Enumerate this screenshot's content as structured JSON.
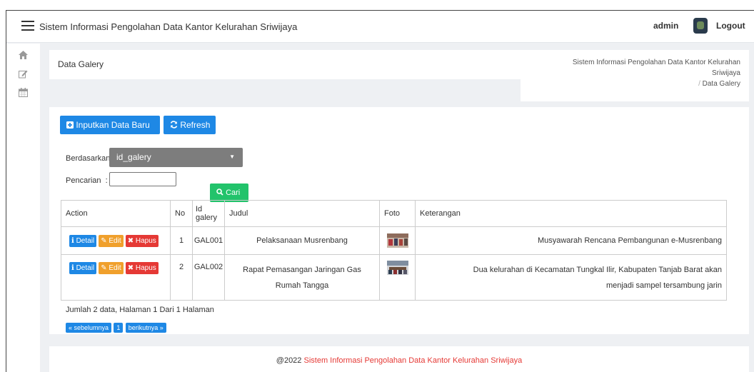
{
  "topbar": {
    "app_title": "Sistem Informasi Pengolahan Data Kantor Kelurahan Sriwijaya",
    "username": "admin",
    "logout_label": "Logout"
  },
  "sidebar": {
    "items": [
      {
        "icon": "home-icon"
      },
      {
        "icon": "edit-icon"
      },
      {
        "icon": "calendar-icon"
      }
    ]
  },
  "header": {
    "page_title": "Data Galery",
    "breadcrumb_root_line1": "Sistem Informasi Pengolahan Data Kantor Kelurahan",
    "breadcrumb_root_line2": "Sriwijaya",
    "breadcrumb_separator": "/",
    "breadcrumb_current": "Data Galery"
  },
  "toolbar": {
    "add_label": "Inputkan Data Baru",
    "refresh_label": "Refresh"
  },
  "filter": {
    "berdasarkan_label": "Berdasarkan",
    "field_selected": "id_galery",
    "pencarian_label": "Pencarian",
    "search_value": "",
    "search_button": "Cari"
  },
  "table": {
    "headers": [
      "Action",
      "No",
      "Id galery",
      "Judul",
      "Foto",
      "Keterangan"
    ],
    "action_labels": {
      "detail": "Detail",
      "edit": "Edit",
      "hapus": "Hapus"
    },
    "rows": [
      {
        "no": "1",
        "id": "GAL001",
        "judul": "Pelaksanaan Musrenbang",
        "judul2": "",
        "keterangan": "Musyawarah Rencana Pembangunan e-Musrenbang",
        "keterangan2": ""
      },
      {
        "no": "2",
        "id": "GAL002",
        "judul": "Rapat Pemasangan Jaringan Gas",
        "judul2": "Rumah Tangga",
        "keterangan": "Dua kelurahan di Kecamatan Tungkal Ilir, Kabupaten Tanjab Barat akan",
        "keterangan2": "menjadi sampel tersambung jarin"
      }
    ]
  },
  "pagination": {
    "summary": "Jumlah 2 data, Halaman 1 Dari 1 Halaman",
    "prev_label": "« sebelumnya",
    "current_page": "1",
    "next_label": "berikutnya »"
  },
  "footer": {
    "prefix": "@2022",
    "link_text": "Sistem Informasi Pengolahan Data Kantor Kelurahan Sriwijaya"
  },
  "colors": {
    "primary": "#1e88e5",
    "success": "#22c36b",
    "warning": "#f0a02c",
    "danger": "#e53935"
  }
}
